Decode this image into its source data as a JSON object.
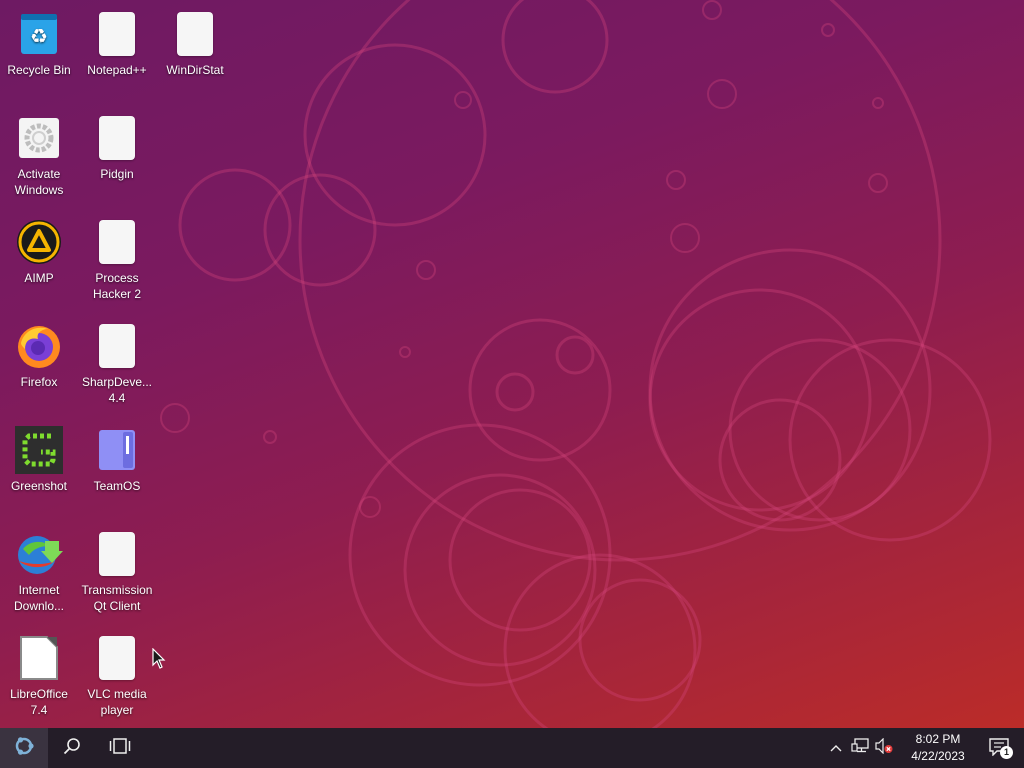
{
  "desktop": {
    "icons": [
      {
        "label": "Recycle Bin",
        "icon": "recycle-bin-icon"
      },
      {
        "label": "Notepad++",
        "icon": "blank-file-icon"
      },
      {
        "label": "WinDirStat",
        "icon": "blank-file-icon"
      },
      {
        "label": "Activate\nWindows",
        "icon": "gear-icon"
      },
      {
        "label": "Pidgin",
        "icon": "blank-file-icon"
      },
      {
        "label": "AIMP",
        "icon": "aimp-icon"
      },
      {
        "label": "Process\nHacker 2",
        "icon": "blank-file-icon"
      },
      {
        "label": "Firefox",
        "icon": "firefox-icon"
      },
      {
        "label": "SharpDeve...\n4.4",
        "icon": "blank-file-icon"
      },
      {
        "label": "Greenshot",
        "icon": "greenshot-icon"
      },
      {
        "label": "TeamOS",
        "icon": "folder-icon"
      },
      {
        "label": "Internet\nDownlo...",
        "icon": "internet-download-manager-icon"
      },
      {
        "label": "Transmission\nQt Client",
        "icon": "blank-file-icon"
      },
      {
        "label": "LibreOffice\n7.4",
        "icon": "libreoffice-icon"
      },
      {
        "label": "VLC media\nplayer",
        "icon": "blank-file-icon"
      }
    ]
  },
  "taskbar": {
    "start_icon": "ubuntu-logo-icon",
    "search_icon": "search-icon",
    "task_view_icon": "task-view-icon",
    "tray": {
      "chevron_icon": "chevron-up-icon",
      "network_icon": "network-icon",
      "volume_icon": "volume-muted-icon",
      "time": "8:02 PM",
      "date": "4/22/2023",
      "notification_icon": "notification-icon",
      "notification_count": "1"
    }
  },
  "colors": {
    "taskbar_bg": "#241d28",
    "wallpaper_top": "#6e1a63",
    "wallpaper_bottom": "#bf2d25"
  }
}
